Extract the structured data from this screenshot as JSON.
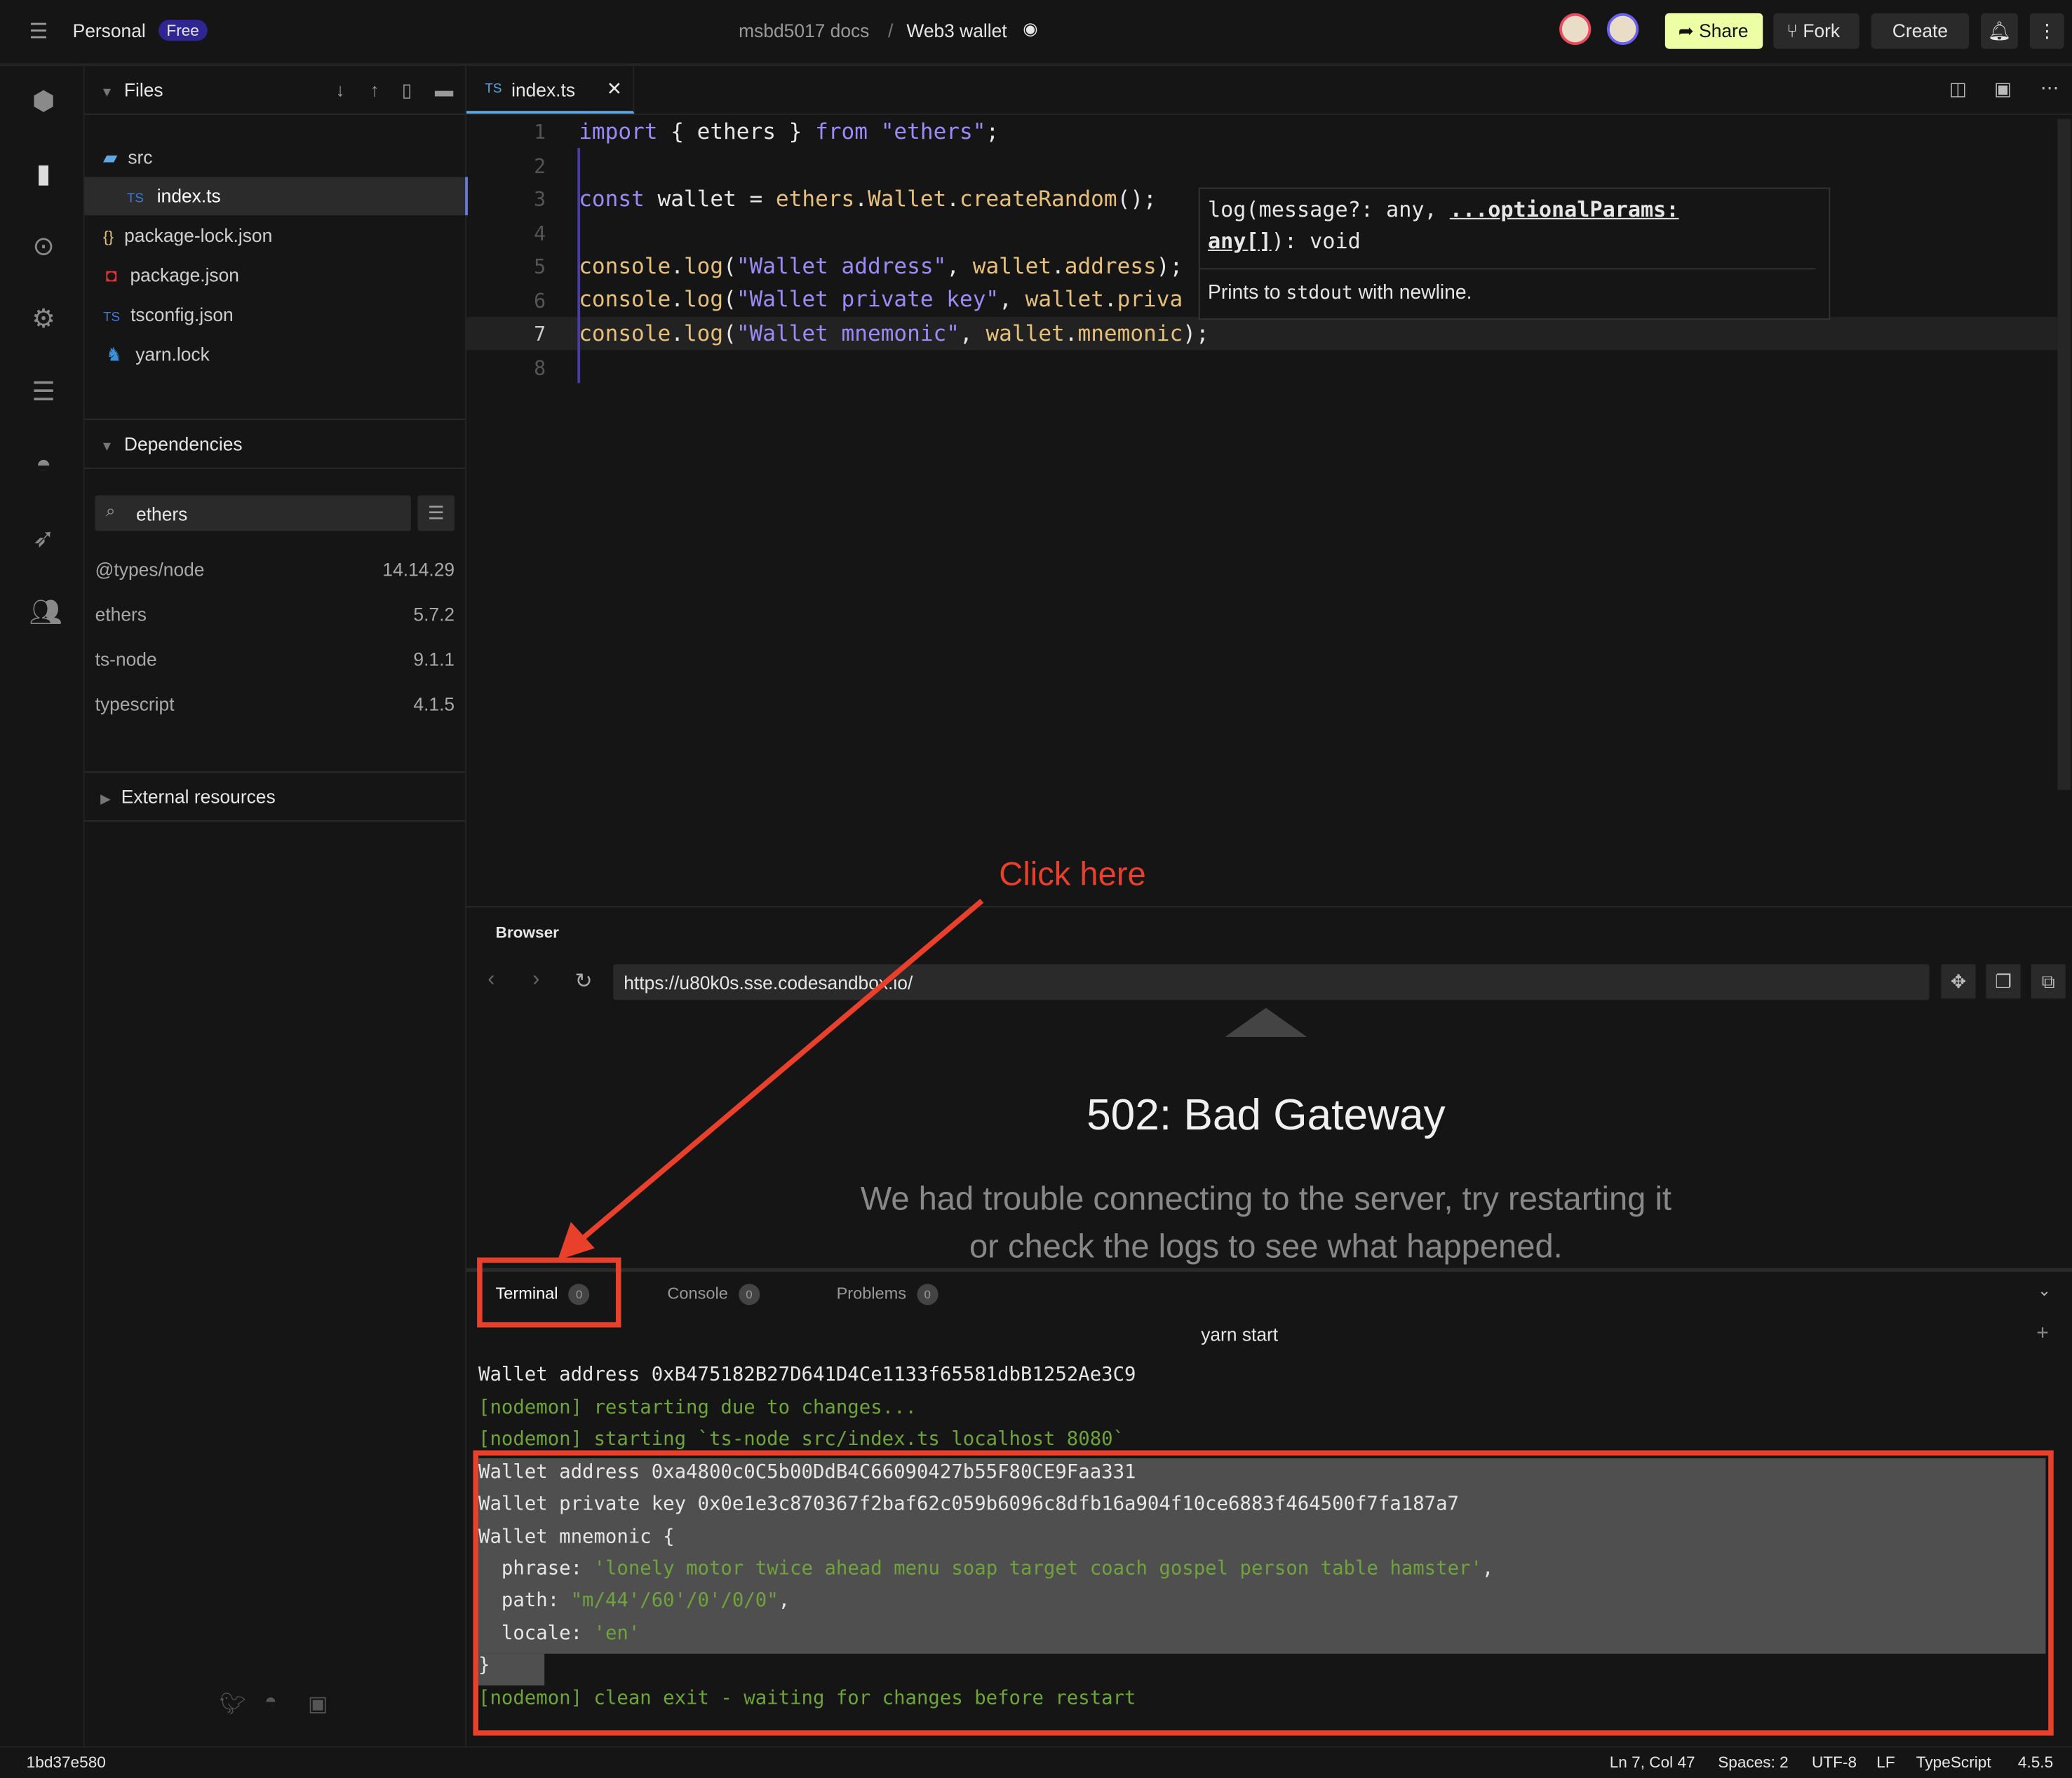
{
  "topbar": {
    "workspace": "Personal",
    "plan_badge": "Free",
    "breadcrumb_parent": "msbd5017 docs",
    "breadcrumb_sep": "/",
    "sandbox_title": "Web3 wallet",
    "share": "Share",
    "fork": "Fork",
    "create": "Create"
  },
  "sidebar": {
    "files_header": "Files",
    "files": [
      {
        "name": "src",
        "icon": "folder-icon"
      },
      {
        "name": "index.ts",
        "icon": "typescript-file-icon"
      },
      {
        "name": "package-lock.json",
        "icon": "json-file-icon"
      },
      {
        "name": "package.json",
        "icon": "npm-icon"
      },
      {
        "name": "tsconfig.json",
        "icon": "typescript-file-icon"
      },
      {
        "name": "yarn.lock",
        "icon": "yarn-icon"
      }
    ],
    "dependencies_header": "Dependencies",
    "dep_search_value": "ethers",
    "dependencies": [
      {
        "name": "@types/node",
        "version": "14.14.29"
      },
      {
        "name": "ethers",
        "version": "5.7.2"
      },
      {
        "name": "ts-node",
        "version": "9.1.1"
      },
      {
        "name": "typescript",
        "version": "4.1.5"
      }
    ],
    "external_header": "External resources"
  },
  "editor": {
    "tab": {
      "lang": "TS",
      "name": "index.ts"
    },
    "line_numbers": [
      "1",
      "2",
      "3",
      "4",
      "5",
      "6",
      "7",
      "8"
    ],
    "lines": [
      "import { ethers } from \"ethers\";",
      "",
      "const wallet = ethers.Wallet.createRandom();",
      "",
      "console.log(\"Wallet address\", wallet.address);",
      "console.log(\"Wallet private key\", wallet.priva",
      "console.log(\"Wallet mnemonic\", wallet.mnemonic);",
      ""
    ],
    "tooltip": {
      "signature_1": "log(message?: any, ",
      "signature_param": "...optionalParams:",
      "signature_2a": "any[]",
      "signature_2b": "): void",
      "desc_pre": "Prints to ",
      "desc_code": "stdout",
      "desc_post": " with newline."
    }
  },
  "browser": {
    "title": "Browser",
    "url": "https://u80k0s.sse.codesandbox.io/",
    "error_title": "502: Bad Gateway",
    "error_line1": "We had trouble connecting to the server, try restarting it",
    "error_line2": "or check the logs to see what happened."
  },
  "panel": {
    "tabs": [
      {
        "label": "Terminal",
        "count": "0"
      },
      {
        "label": "Console",
        "count": "0"
      },
      {
        "label": "Problems",
        "count": "0"
      }
    ],
    "terminal_title": "yarn start",
    "lines": [
      "Wallet address 0xB475182B27D641D4Ce1133f65581dbB1252Ae3C9",
      "[nodemon] restarting due to changes...",
      "[nodemon] starting `ts-node src/index.ts localhost 8080`",
      "Wallet address 0xa4800c0C5b00DdB4C66090427b55F80CE9Faa331",
      "Wallet private key 0x0e1e3c870367f2baf62c059b6096c8dfb16a904f10ce6883f464500f7fa187a7",
      "Wallet mnemonic {"
    ],
    "phrase_key": "  phrase: ",
    "phrase_val": "'lonely motor twice ahead menu soap target coach gospel person table hamster'",
    "path_key": "  path: ",
    "path_val": "\"m/44'/60'/0'/0/0\"",
    "locale_key": "  locale: ",
    "locale_val": "'en'",
    "close_brace": "}",
    "last_line": "[nodemon] clean exit - waiting for changes before restart"
  },
  "annotation": {
    "text": "Click here",
    "color": "#e8402b"
  },
  "status": {
    "commit": "1bd37e580",
    "position": "Ln 7, Col 47",
    "spaces": "Spaces: 2",
    "encoding": "UTF-8",
    "eol": "LF",
    "language": "TypeScript",
    "version": "4.5.5"
  },
  "colors": {
    "accent": "#2f2593",
    "share_bg": "#edffa5",
    "tab_underline": "#5fa8e0"
  }
}
